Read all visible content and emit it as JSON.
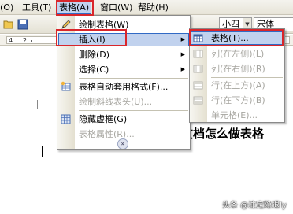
{
  "menubar": {
    "partial_item": "(O)",
    "items": [
      "工具(T)",
      "表格(A)",
      "窗口(W)",
      "帮助(H)"
    ]
  },
  "toolbar": {
    "partial_text": "文",
    "font_size": "小四",
    "font_name": "宋体",
    "plus": "+"
  },
  "ruler": {
    "numbers": [
      "4",
      "2"
    ]
  },
  "table_menu": {
    "items": [
      {
        "label": "绘制表格(W)",
        "icon": "pencil-icon",
        "enabled": true
      },
      {
        "label": "插入(I)",
        "icon": "",
        "enabled": true,
        "submenu": true,
        "highlighted": true
      },
      {
        "label": "删除(D)",
        "icon": "",
        "enabled": true,
        "submenu": true
      },
      {
        "label": "选择(C)",
        "icon": "",
        "enabled": true,
        "submenu": true
      },
      {
        "label": "表格自动套用格式(F)...",
        "icon": "table-autoformat-icon",
        "enabled": true
      },
      {
        "label": "绘制斜线表头(U)...",
        "icon": "",
        "enabled": false
      },
      {
        "label": "隐藏虚框(G)",
        "icon": "gridlines-icon",
        "enabled": true
      },
      {
        "label": "表格属性(R)...",
        "icon": "",
        "enabled": false
      }
    ],
    "expand_icon": "double-chevron-down-icon"
  },
  "insert_submenu": {
    "items": [
      {
        "label": "表格(T)...",
        "icon": "table-icon",
        "enabled": true,
        "highlighted": true
      },
      {
        "label": "列(在左侧)(L)",
        "icon": "column-left-icon",
        "enabled": false
      },
      {
        "label": "列(在右侧)(R)",
        "icon": "column-right-icon",
        "enabled": false
      },
      {
        "label": "行(在上方)(A)",
        "icon": "row-above-icon",
        "enabled": false
      },
      {
        "label": "行(在下方)(B)",
        "icon": "row-below-icon",
        "enabled": false
      },
      {
        "label": "单元格(E)...",
        "icon": "",
        "enabled": false
      }
    ]
  },
  "document": {
    "title_fragment": "文档怎么做表格"
  },
  "watermark": "头条 @注定隐退ly",
  "colors": {
    "highlight_bg": "#c1d2ee",
    "highlight_border": "#316ac5",
    "annotation_red": "#d9262b"
  }
}
